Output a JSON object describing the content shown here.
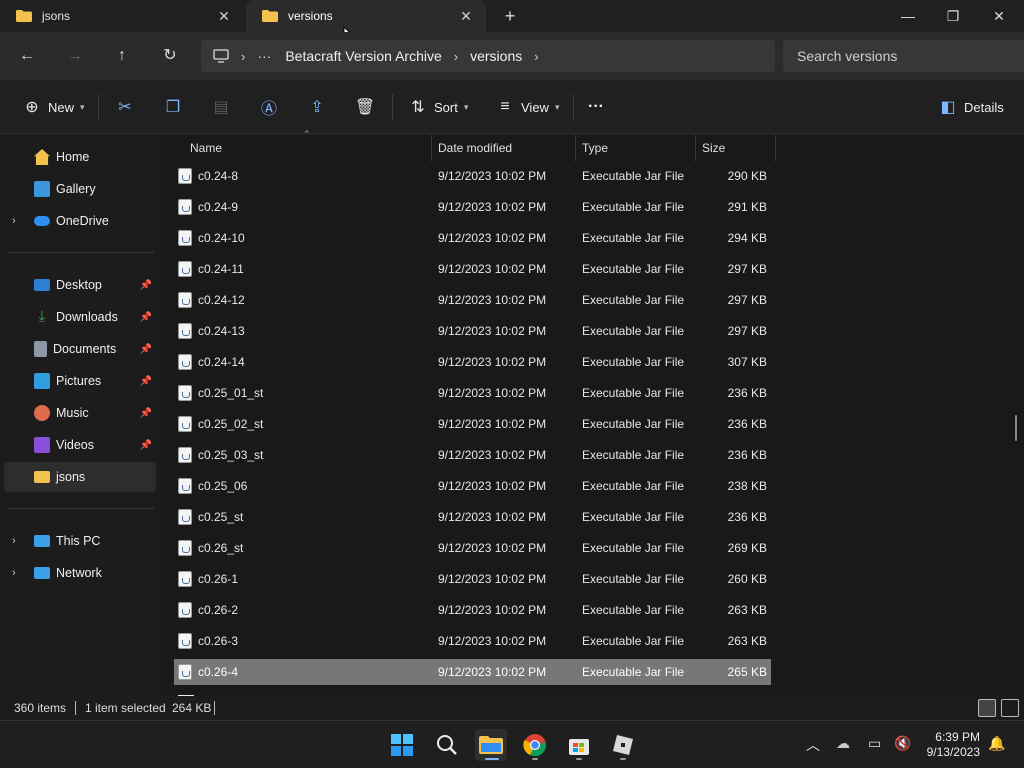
{
  "tabs": [
    {
      "label": "jsons",
      "active": false
    },
    {
      "label": "versions",
      "active": true
    }
  ],
  "address": {
    "crumbs": [
      "Betacraft Version Archive",
      "versions"
    ],
    "search_placeholder": "Search versions"
  },
  "toolbar": {
    "new_label": "New",
    "sort_label": "Sort",
    "view_label": "View",
    "more_label": "···",
    "details_label": "Details"
  },
  "sidebar": {
    "items": [
      {
        "label": "Home",
        "color": "#f2c14e"
      },
      {
        "label": "Gallery",
        "color": "#3a96dd"
      },
      {
        "label": "OneDrive",
        "color": "#2f8ff0"
      },
      {
        "label": "Desktop",
        "color": "#2d7fd3"
      },
      {
        "label": "Downloads",
        "color": "#3fa54a"
      },
      {
        "label": "Documents",
        "color": "#8f97a6"
      },
      {
        "label": "Pictures",
        "color": "#2f9ee0"
      },
      {
        "label": "Music",
        "color": "#e06c4b"
      },
      {
        "label": "Videos",
        "color": "#8a4fd8"
      },
      {
        "label": "jsons",
        "color": "#f2c14e"
      },
      {
        "label": "This PC",
        "color": "#3aa0e8"
      },
      {
        "label": "Network",
        "color": "#3aa0e8"
      }
    ]
  },
  "columns": {
    "name": "Name",
    "date": "Date modified",
    "type": "Type",
    "size": "Size"
  },
  "files": [
    {
      "name": "c0.24-8",
      "date": "9/12/2023 10:02 PM",
      "type": "Executable Jar File",
      "size": "290 KB"
    },
    {
      "name": "c0.24-9",
      "date": "9/12/2023 10:02 PM",
      "type": "Executable Jar File",
      "size": "291 KB"
    },
    {
      "name": "c0.24-10",
      "date": "9/12/2023 10:02 PM",
      "type": "Executable Jar File",
      "size": "294 KB"
    },
    {
      "name": "c0.24-11",
      "date": "9/12/2023 10:02 PM",
      "type": "Executable Jar File",
      "size": "297 KB"
    },
    {
      "name": "c0.24-12",
      "date": "9/12/2023 10:02 PM",
      "type": "Executable Jar File",
      "size": "297 KB"
    },
    {
      "name": "c0.24-13",
      "date": "9/12/2023 10:02 PM",
      "type": "Executable Jar File",
      "size": "297 KB"
    },
    {
      "name": "c0.24-14",
      "date": "9/12/2023 10:02 PM",
      "type": "Executable Jar File",
      "size": "307 KB"
    },
    {
      "name": "c0.25_01_st",
      "date": "9/12/2023 10:02 PM",
      "type": "Executable Jar File",
      "size": "236 KB"
    },
    {
      "name": "c0.25_02_st",
      "date": "9/12/2023 10:02 PM",
      "type": "Executable Jar File",
      "size": "236 KB"
    },
    {
      "name": "c0.25_03_st",
      "date": "9/12/2023 10:02 PM",
      "type": "Executable Jar File",
      "size": "236 KB"
    },
    {
      "name": "c0.25_06",
      "date": "9/12/2023 10:02 PM",
      "type": "Executable Jar File",
      "size": "238 KB"
    },
    {
      "name": "c0.25_st",
      "date": "9/12/2023 10:02 PM",
      "type": "Executable Jar File",
      "size": "236 KB"
    },
    {
      "name": "c0.26_st",
      "date": "9/12/2023 10:02 PM",
      "type": "Executable Jar File",
      "size": "269 KB"
    },
    {
      "name": "c0.26-1",
      "date": "9/12/2023 10:02 PM",
      "type": "Executable Jar File",
      "size": "260 KB"
    },
    {
      "name": "c0.26-2",
      "date": "9/12/2023 10:02 PM",
      "type": "Executable Jar File",
      "size": "263 KB"
    },
    {
      "name": "c0.26-3",
      "date": "9/12/2023 10:02 PM",
      "type": "Executable Jar File",
      "size": "263 KB"
    },
    {
      "name": "c0.26-4",
      "date": "9/12/2023 10:02 PM",
      "type": "Executable Jar File",
      "size": "265 KB",
      "selected": true
    }
  ],
  "status": {
    "item_count": "360 items",
    "selection": "1 item selected",
    "selection_size": "264 KB"
  },
  "clock": {
    "time": "6:39 PM",
    "date": "9/13/2023"
  }
}
